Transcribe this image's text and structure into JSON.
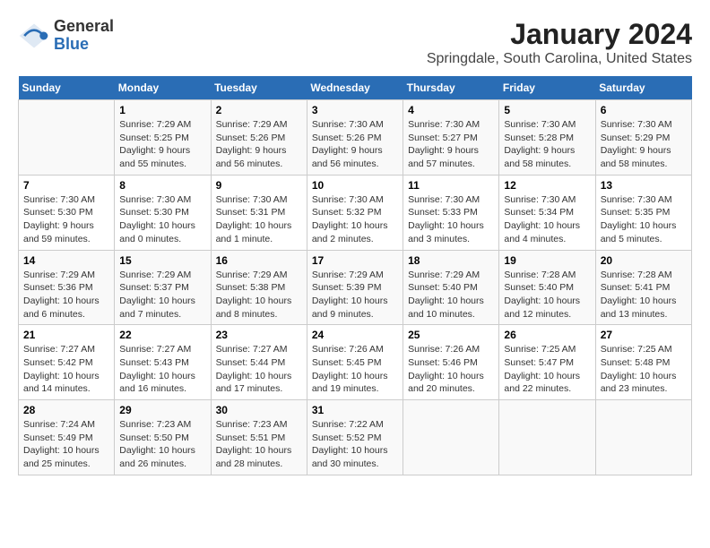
{
  "header": {
    "logo": {
      "general": "General",
      "blue": "Blue"
    },
    "title": "January 2024",
    "subtitle": "Springdale, South Carolina, United States"
  },
  "calendar": {
    "days_of_week": [
      "Sunday",
      "Monday",
      "Tuesday",
      "Wednesday",
      "Thursday",
      "Friday",
      "Saturday"
    ],
    "weeks": [
      [
        {
          "day": "",
          "sunrise": "",
          "sunset": "",
          "daylight": ""
        },
        {
          "day": "1",
          "sunrise": "Sunrise: 7:29 AM",
          "sunset": "Sunset: 5:25 PM",
          "daylight": "Daylight: 9 hours and 55 minutes."
        },
        {
          "day": "2",
          "sunrise": "Sunrise: 7:29 AM",
          "sunset": "Sunset: 5:26 PM",
          "daylight": "Daylight: 9 hours and 56 minutes."
        },
        {
          "day": "3",
          "sunrise": "Sunrise: 7:30 AM",
          "sunset": "Sunset: 5:26 PM",
          "daylight": "Daylight: 9 hours and 56 minutes."
        },
        {
          "day": "4",
          "sunrise": "Sunrise: 7:30 AM",
          "sunset": "Sunset: 5:27 PM",
          "daylight": "Daylight: 9 hours and 57 minutes."
        },
        {
          "day": "5",
          "sunrise": "Sunrise: 7:30 AM",
          "sunset": "Sunset: 5:28 PM",
          "daylight": "Daylight: 9 hours and 58 minutes."
        },
        {
          "day": "6",
          "sunrise": "Sunrise: 7:30 AM",
          "sunset": "Sunset: 5:29 PM",
          "daylight": "Daylight: 9 hours and 58 minutes."
        }
      ],
      [
        {
          "day": "7",
          "sunrise": "Sunrise: 7:30 AM",
          "sunset": "Sunset: 5:30 PM",
          "daylight": "Daylight: 9 hours and 59 minutes."
        },
        {
          "day": "8",
          "sunrise": "Sunrise: 7:30 AM",
          "sunset": "Sunset: 5:30 PM",
          "daylight": "Daylight: 10 hours and 0 minutes."
        },
        {
          "day": "9",
          "sunrise": "Sunrise: 7:30 AM",
          "sunset": "Sunset: 5:31 PM",
          "daylight": "Daylight: 10 hours and 1 minute."
        },
        {
          "day": "10",
          "sunrise": "Sunrise: 7:30 AM",
          "sunset": "Sunset: 5:32 PM",
          "daylight": "Daylight: 10 hours and 2 minutes."
        },
        {
          "day": "11",
          "sunrise": "Sunrise: 7:30 AM",
          "sunset": "Sunset: 5:33 PM",
          "daylight": "Daylight: 10 hours and 3 minutes."
        },
        {
          "day": "12",
          "sunrise": "Sunrise: 7:30 AM",
          "sunset": "Sunset: 5:34 PM",
          "daylight": "Daylight: 10 hours and 4 minutes."
        },
        {
          "day": "13",
          "sunrise": "Sunrise: 7:30 AM",
          "sunset": "Sunset: 5:35 PM",
          "daylight": "Daylight: 10 hours and 5 minutes."
        }
      ],
      [
        {
          "day": "14",
          "sunrise": "Sunrise: 7:29 AM",
          "sunset": "Sunset: 5:36 PM",
          "daylight": "Daylight: 10 hours and 6 minutes."
        },
        {
          "day": "15",
          "sunrise": "Sunrise: 7:29 AM",
          "sunset": "Sunset: 5:37 PM",
          "daylight": "Daylight: 10 hours and 7 minutes."
        },
        {
          "day": "16",
          "sunrise": "Sunrise: 7:29 AM",
          "sunset": "Sunset: 5:38 PM",
          "daylight": "Daylight: 10 hours and 8 minutes."
        },
        {
          "day": "17",
          "sunrise": "Sunrise: 7:29 AM",
          "sunset": "Sunset: 5:39 PM",
          "daylight": "Daylight: 10 hours and 9 minutes."
        },
        {
          "day": "18",
          "sunrise": "Sunrise: 7:29 AM",
          "sunset": "Sunset: 5:40 PM",
          "daylight": "Daylight: 10 hours and 10 minutes."
        },
        {
          "day": "19",
          "sunrise": "Sunrise: 7:28 AM",
          "sunset": "Sunset: 5:40 PM",
          "daylight": "Daylight: 10 hours and 12 minutes."
        },
        {
          "day": "20",
          "sunrise": "Sunrise: 7:28 AM",
          "sunset": "Sunset: 5:41 PM",
          "daylight": "Daylight: 10 hours and 13 minutes."
        }
      ],
      [
        {
          "day": "21",
          "sunrise": "Sunrise: 7:27 AM",
          "sunset": "Sunset: 5:42 PM",
          "daylight": "Daylight: 10 hours and 14 minutes."
        },
        {
          "day": "22",
          "sunrise": "Sunrise: 7:27 AM",
          "sunset": "Sunset: 5:43 PM",
          "daylight": "Daylight: 10 hours and 16 minutes."
        },
        {
          "day": "23",
          "sunrise": "Sunrise: 7:27 AM",
          "sunset": "Sunset: 5:44 PM",
          "daylight": "Daylight: 10 hours and 17 minutes."
        },
        {
          "day": "24",
          "sunrise": "Sunrise: 7:26 AM",
          "sunset": "Sunset: 5:45 PM",
          "daylight": "Daylight: 10 hours and 19 minutes."
        },
        {
          "day": "25",
          "sunrise": "Sunrise: 7:26 AM",
          "sunset": "Sunset: 5:46 PM",
          "daylight": "Daylight: 10 hours and 20 minutes."
        },
        {
          "day": "26",
          "sunrise": "Sunrise: 7:25 AM",
          "sunset": "Sunset: 5:47 PM",
          "daylight": "Daylight: 10 hours and 22 minutes."
        },
        {
          "day": "27",
          "sunrise": "Sunrise: 7:25 AM",
          "sunset": "Sunset: 5:48 PM",
          "daylight": "Daylight: 10 hours and 23 minutes."
        }
      ],
      [
        {
          "day": "28",
          "sunrise": "Sunrise: 7:24 AM",
          "sunset": "Sunset: 5:49 PM",
          "daylight": "Daylight: 10 hours and 25 minutes."
        },
        {
          "day": "29",
          "sunrise": "Sunrise: 7:23 AM",
          "sunset": "Sunset: 5:50 PM",
          "daylight": "Daylight: 10 hours and 26 minutes."
        },
        {
          "day": "30",
          "sunrise": "Sunrise: 7:23 AM",
          "sunset": "Sunset: 5:51 PM",
          "daylight": "Daylight: 10 hours and 28 minutes."
        },
        {
          "day": "31",
          "sunrise": "Sunrise: 7:22 AM",
          "sunset": "Sunset: 5:52 PM",
          "daylight": "Daylight: 10 hours and 30 minutes."
        },
        {
          "day": "",
          "sunrise": "",
          "sunset": "",
          "daylight": ""
        },
        {
          "day": "",
          "sunrise": "",
          "sunset": "",
          "daylight": ""
        },
        {
          "day": "",
          "sunrise": "",
          "sunset": "",
          "daylight": ""
        }
      ]
    ]
  }
}
